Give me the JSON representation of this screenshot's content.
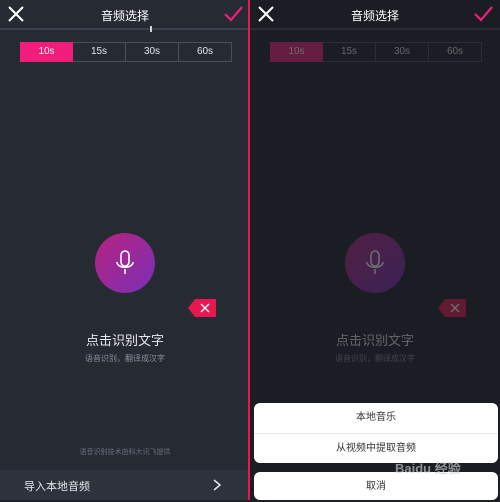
{
  "left": {
    "header": {
      "title": "音频选择"
    },
    "tabs": [
      {
        "label": "10s",
        "active": true
      },
      {
        "label": "15s",
        "active": false
      },
      {
        "label": "30s",
        "active": false
      },
      {
        "label": "60s",
        "active": false
      }
    ],
    "main_label": "点击识别文字",
    "sub_label": "语音识别，翻译成汉字",
    "footnote": "语音识别技术由科大讯飞提供",
    "import_label": "导入本地音频"
  },
  "right": {
    "header": {
      "title": "音频选择"
    },
    "tabs": [
      {
        "label": "10s",
        "active": true
      },
      {
        "label": "15s",
        "active": false
      },
      {
        "label": "30s",
        "active": false
      },
      {
        "label": "60s",
        "active": false
      }
    ],
    "main_label": "点击识别文字",
    "sub_label": "语音识别，翻译成汉字",
    "action_sheet": {
      "items": [
        "本地音乐",
        "从视频中提取音频"
      ],
      "cancel": "取消"
    },
    "watermark": "Baidu 经验"
  },
  "colors": {
    "accent": "#f11d7a",
    "divider": "#e8174f",
    "mic_start": "#b7237d",
    "mic_end": "#7a2fb8"
  }
}
